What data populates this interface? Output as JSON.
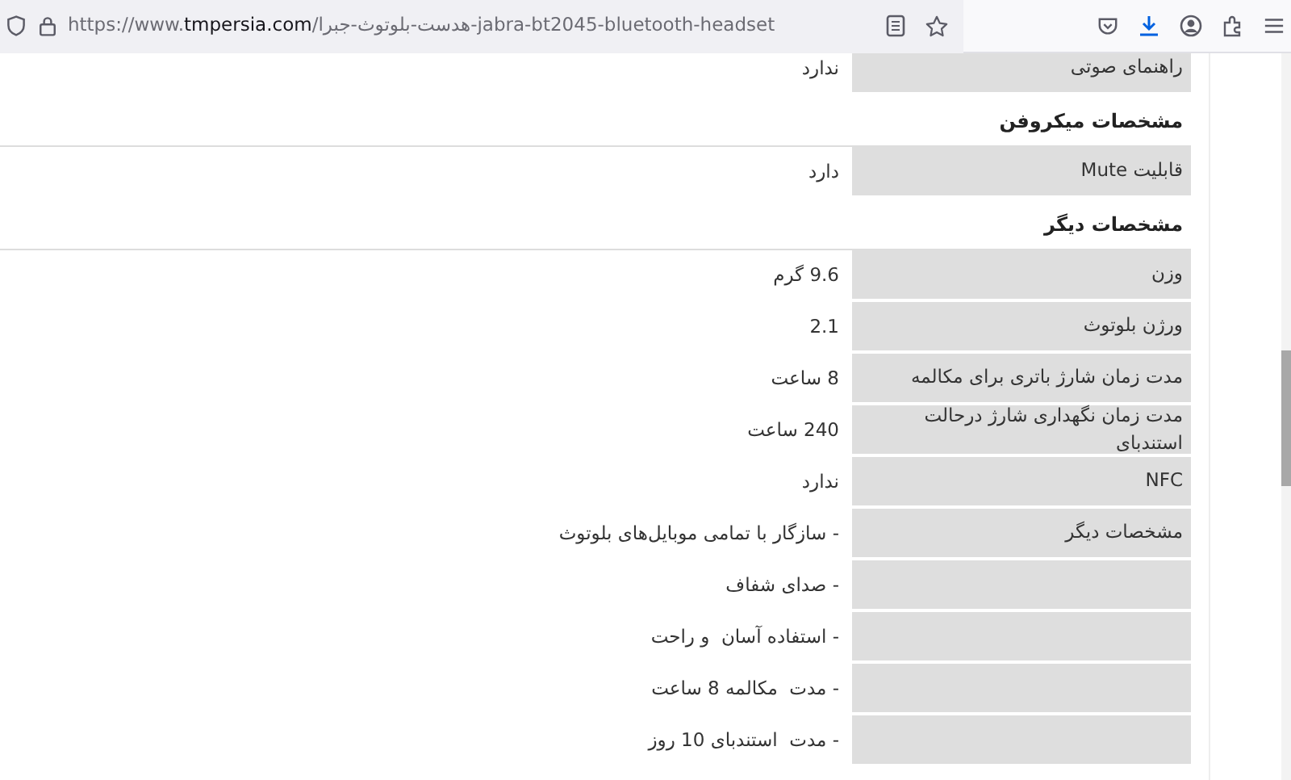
{
  "toolbar": {
    "url": "https://www.**tmpersia.com**/هدست-بلوتوث-جبرا-jabra-bt2045-bluetooth-headset"
  },
  "specs": [
    {
      "kind": "row",
      "label": "راهنمای صوتی",
      "value": "ندارد"
    },
    {
      "kind": "heading",
      "label": "مشخصات میکروفن"
    },
    {
      "kind": "row",
      "label": "قابلیت Mute",
      "value": "دارد"
    },
    {
      "kind": "heading",
      "label": "مشخصات دیگر"
    },
    {
      "kind": "row",
      "label": "وزن",
      "value": "9.6 گرم"
    },
    {
      "kind": "row",
      "label": "ورژن بلوتوث",
      "value": "2.1"
    },
    {
      "kind": "row",
      "label": "مدت زمان شارژ باتری برای مکالمه",
      "value": "8 ساعت"
    },
    {
      "kind": "row",
      "label": "مدت زمان نگهداری شارژ درحالت استندبای",
      "value": "240 ساعت"
    },
    {
      "kind": "row",
      "label": "NFC",
      "value": "ندارد"
    },
    {
      "kind": "row",
      "label": "مشخصات دیگر",
      "value": "- سازگار با تمامی موبایل‌های بلوتوث"
    },
    {
      "kind": "row",
      "value": "- صدای شفاف"
    },
    {
      "kind": "row",
      "value": "- استفاده آسان  و راحت"
    },
    {
      "kind": "row",
      "value": "- مدت  مکالمه 8 ساعت"
    },
    {
      "kind": "row",
      "value": "- مدت  استندبای 10 روز"
    }
  ]
}
